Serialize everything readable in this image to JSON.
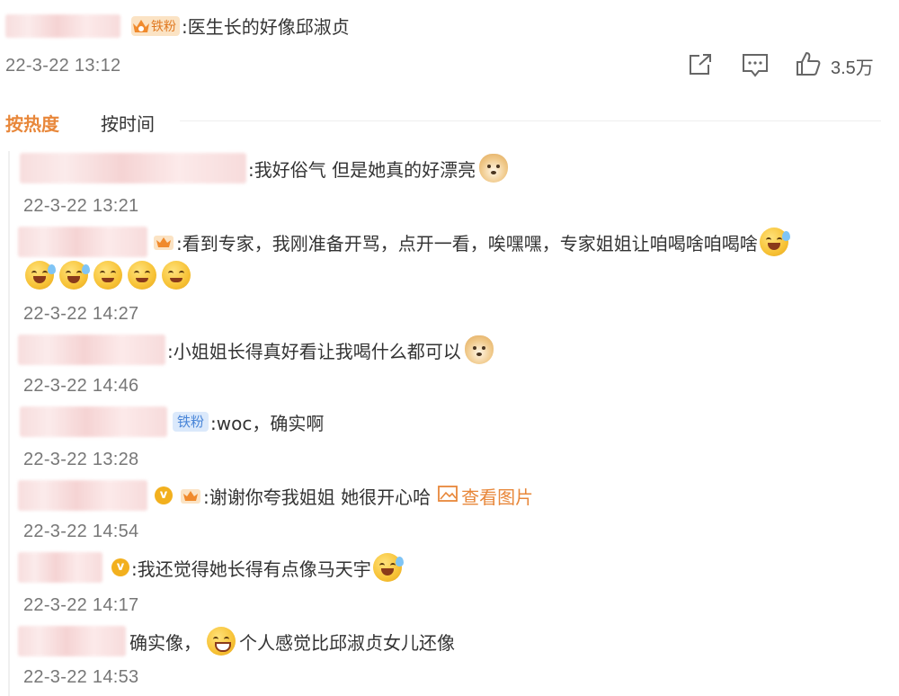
{
  "post": {
    "tag": "铁粉",
    "text": ":医生长的好像邱淑贞",
    "time": "22-3-22 13:12",
    "likes": "3.5万"
  },
  "tabs": {
    "hot": "按热度",
    "time": "按时间"
  },
  "accent_color": "#e8873a",
  "replies": [
    {
      "text": ":我好俗气 但是她真的好漂亮",
      "time": "22-3-22 13:21",
      "emoji": "doge-blush"
    },
    {
      "text": ":看到专家，我刚准备开骂，点开一看，唉嘿嘿，专家姐姐让咱喝啥咱喝啥",
      "time": "22-3-22 14:27",
      "emoji": "tears-of-joy"
    },
    {
      "text": ":小姐姐长得真好看让我喝什么都可以",
      "time": "22-3-22 14:46",
      "emoji": "doge"
    },
    {
      "tag": "铁粉",
      "text": ":woc，确实啊",
      "time": "22-3-22 13:28"
    },
    {
      "text": ":谢谢你夸我姐姐 她很开心哈",
      "link": "查看图片",
      "time": "22-3-22 14:54"
    },
    {
      "text": ":我还觉得她长得有点像马天宇",
      "time": "22-3-22 14:17",
      "emoji": "laugh-cry"
    },
    {
      "text_before": "确实像，",
      "text_after": "个人感觉比邱淑贞女儿还像",
      "time": "22-3-22 14:53",
      "emoji": "grin"
    }
  ]
}
